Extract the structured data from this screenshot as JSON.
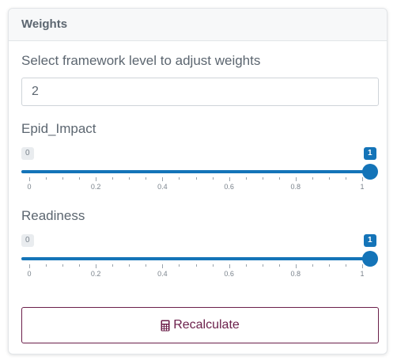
{
  "card": {
    "title": "Weights"
  },
  "framework": {
    "label": "Select framework level to adjust weights",
    "value": "2"
  },
  "sliders": [
    {
      "label": "Epid_Impact",
      "min_label": "0",
      "value_label": "1",
      "value": 1,
      "min": 0,
      "max": 1,
      "ticks": [
        "0",
        "0.2",
        "0.4",
        "0.6",
        "0.8",
        "1"
      ]
    },
    {
      "label": "Readiness",
      "min_label": "0",
      "value_label": "1",
      "value": 1,
      "min": 0,
      "max": 1,
      "ticks": [
        "0",
        "0.2",
        "0.4",
        "0.6",
        "0.8",
        "1"
      ]
    }
  ],
  "button": {
    "label": "Recalculate",
    "icon": "calculator-icon"
  },
  "colors": {
    "accent": "#1474b8",
    "button": "#6b1f4a"
  }
}
